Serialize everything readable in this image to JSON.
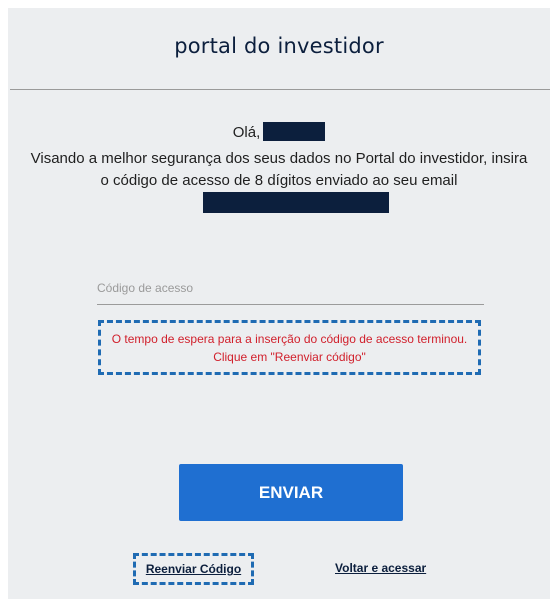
{
  "header": {
    "title": "portal do investidor"
  },
  "message": {
    "greeting": "Olá,",
    "line1": "Visando a melhor segurança dos seus dados no Portal do investidor, insira",
    "line2": "o código de acesso de 8 dígitos enviado ao seu email"
  },
  "form": {
    "code_placeholder": "Código de acesso",
    "code_value": ""
  },
  "alert": {
    "text": "O tempo de espera para a inserção do código de acesso terminou. Clique em \"Reenviar código\""
  },
  "actions": {
    "send_label": "ENVIAR",
    "resend_label": "Reenviar Código",
    "back_label": "Voltar e acessar"
  },
  "colors": {
    "brand_dark": "#0c1f3d",
    "primary_button": "#1f6fd1",
    "error_text": "#d1202c",
    "highlight_border": "#1f6bb3",
    "panel_bg": "#eceef0"
  }
}
